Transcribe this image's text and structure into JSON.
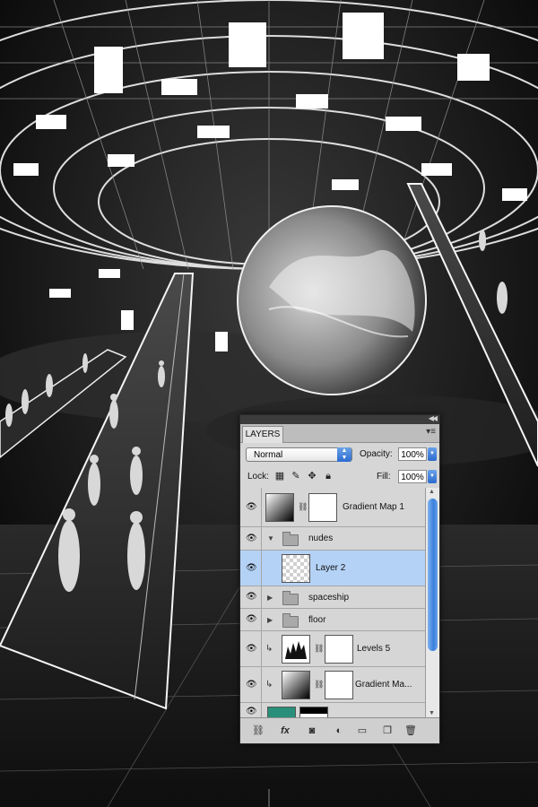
{
  "panel": {
    "tab_label": "LAYERS",
    "blend_mode": "Normal",
    "opacity_label": "Opacity:",
    "opacity_value": "100%",
    "lock_label": "Lock:",
    "fill_label": "Fill:",
    "fill_value": "100%"
  },
  "layers": [
    {
      "name": "Gradient Map 1",
      "kind": "adjustment-gradient",
      "visible": true,
      "selected": false
    },
    {
      "name": "nudes",
      "kind": "group-open",
      "visible": true,
      "selected": false
    },
    {
      "name": "Layer 2",
      "kind": "pixel",
      "visible": true,
      "selected": true
    },
    {
      "name": "spaceship",
      "kind": "group-closed",
      "visible": true,
      "selected": false
    },
    {
      "name": "floor",
      "kind": "group-closed",
      "visible": true,
      "selected": false
    },
    {
      "name": "Levels 5",
      "kind": "adjustment-levels",
      "visible": true,
      "selected": false
    },
    {
      "name": "Gradient Ma...",
      "kind": "adjustment-gradient",
      "visible": true,
      "selected": false
    }
  ],
  "icons": {
    "visibility": "eye-icon",
    "link_mask": "chain-icon",
    "footer": [
      "link-layers-icon",
      "fx-icon",
      "add-mask-icon",
      "adjustment-icon",
      "new-group-icon",
      "new-layer-icon",
      "trash-icon"
    ]
  },
  "colors": {
    "selection": "#b4d2f5",
    "accent": "#3a7fdc"
  }
}
